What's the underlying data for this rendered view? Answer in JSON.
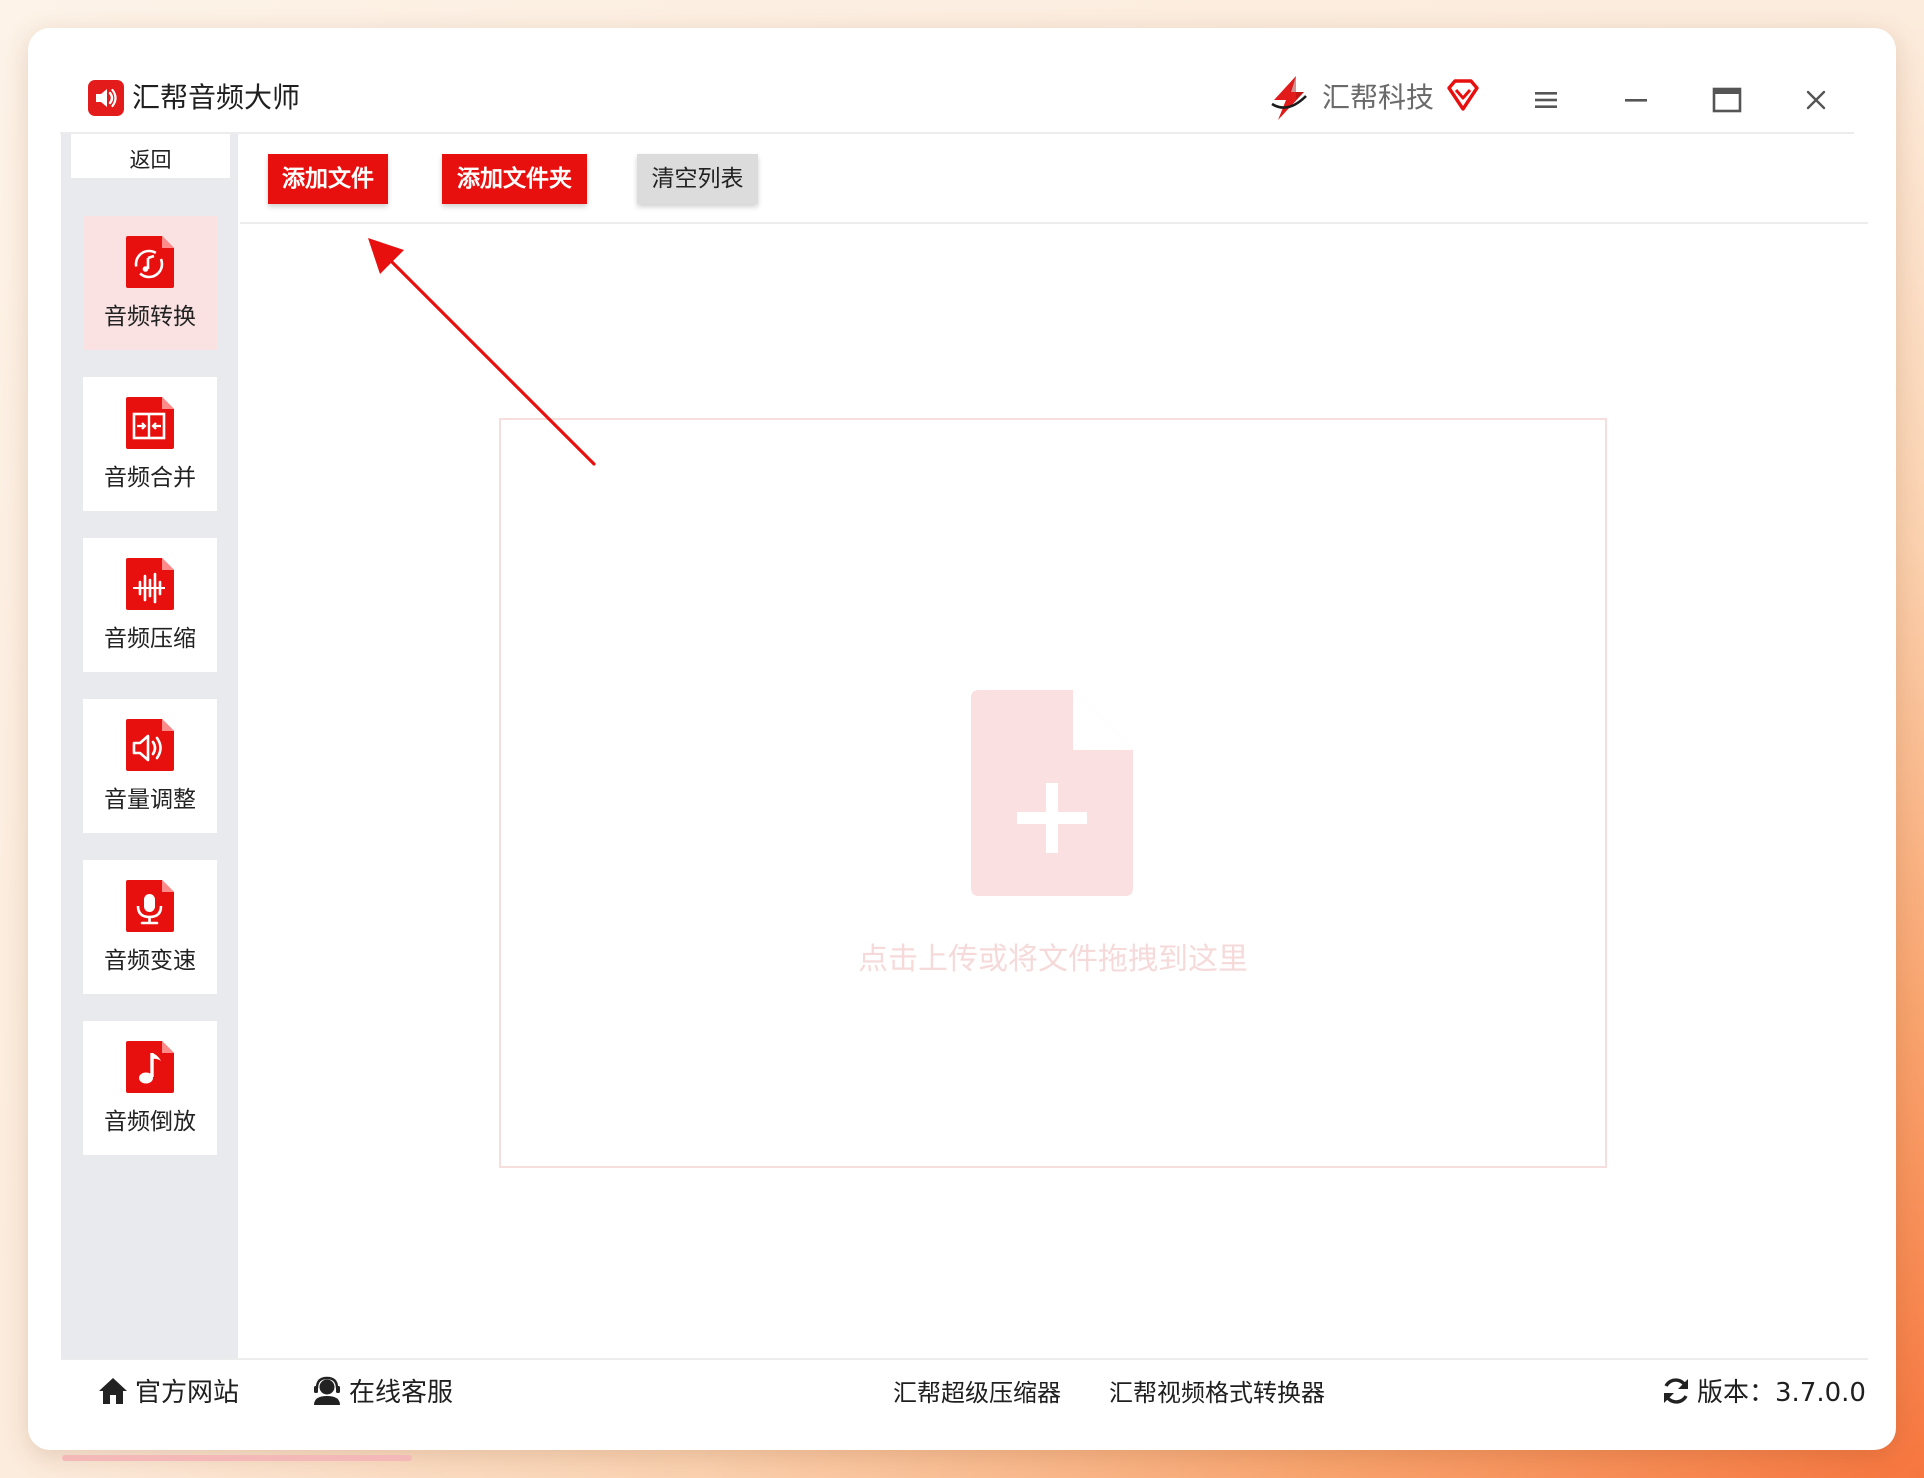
{
  "app": {
    "title": "汇帮音频大师",
    "brand": "汇帮科技"
  },
  "colors": {
    "accent": "#e8100f",
    "active_nav_bg": "#fae2e2",
    "sidebar_bg": "#e9eaee",
    "dropzone_text": "#f6dada"
  },
  "sidebar": {
    "back_label": "返回",
    "items": [
      {
        "label": "音频转换",
        "icon": "audio-convert-icon",
        "active": true
      },
      {
        "label": "音频合并",
        "icon": "audio-merge-icon",
        "active": false
      },
      {
        "label": "音频压缩",
        "icon": "audio-compress-icon",
        "active": false
      },
      {
        "label": "音量调整",
        "icon": "volume-adjust-icon",
        "active": false
      },
      {
        "label": "音频变速",
        "icon": "microphone-icon",
        "active": false
      },
      {
        "label": "音频倒放",
        "icon": "music-note-icon",
        "active": false
      }
    ]
  },
  "toolbar": {
    "add_file": "添加文件",
    "add_folder": "添加文件夹",
    "clear_list": "清空列表"
  },
  "dropzone": {
    "hint": "点击上传或将文件拖拽到这里",
    "icon": "file-add-icon"
  },
  "footer": {
    "website": "官方网站",
    "support": "在线客服",
    "compressor": "汇帮超级压缩器",
    "video_converter": "汇帮视频格式转换器",
    "version_label": "版本：",
    "version": "3.7.0.0"
  }
}
